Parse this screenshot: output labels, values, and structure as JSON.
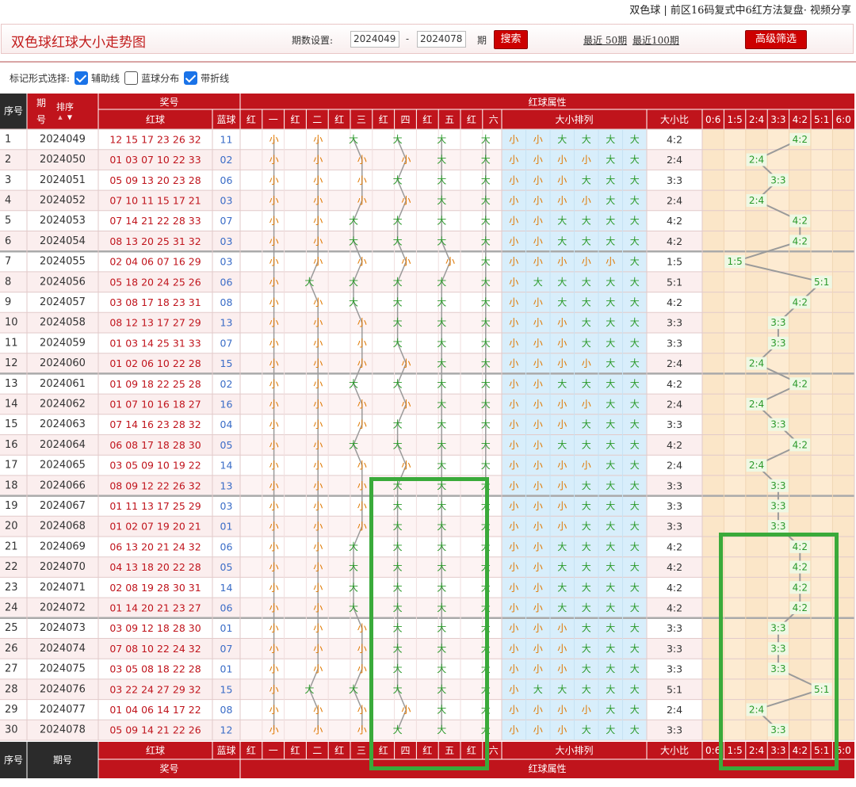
{
  "topbar": {
    "title": "双色球 | 前区16码复式中6红方法复盘· 视频分享"
  },
  "header": {
    "title": "双色球红球大小走势图",
    "period_label": "期数设置:",
    "period_from": "2024049",
    "period_sep": "-",
    "period_to": "2024078",
    "period_unit": "期",
    "search_label": "搜索",
    "recent50_label": "最近 50期",
    "recent100_label": "最近100期",
    "advanced_label": "高级筛选"
  },
  "options": {
    "label": "标记形式选择:",
    "items": [
      {
        "label": "辅助线",
        "checked": true
      },
      {
        "label": "蓝球分布",
        "checked": false
      },
      {
        "label": "带折线",
        "checked": true
      }
    ]
  },
  "table": {
    "head": {
      "seq": "序号",
      "issue": "期号",
      "issue_top": "期",
      "issue_bottom": "号",
      "sort": "排序",
      "prize": "奖号",
      "red_ball": "红球",
      "blue_ball": "蓝球",
      "attr": "红球属性",
      "positions": [
        "红",
        "一",
        "红",
        "二",
        "红",
        "三",
        "红",
        "四",
        "红",
        "五",
        "红",
        "六"
      ],
      "size_arrange": "大小排列",
      "ratio": "大小比",
      "ratio_cols": [
        "0:6",
        "1:5",
        "2:4",
        "3:3",
        "4:2",
        "5:1",
        "6:0"
      ]
    },
    "rows": [
      {
        "seq": "1",
        "issue": "2024049",
        "red": "12 15 17 23 26 32",
        "blue": "11",
        "sizes": [
          "小",
          "小",
          "大",
          "大",
          "大",
          "大"
        ],
        "ratio": "4:2"
      },
      {
        "seq": "2",
        "issue": "2024050",
        "red": "01 03 07 10 22 33",
        "blue": "02",
        "sizes": [
          "小",
          "小",
          "小",
          "小",
          "大",
          "大"
        ],
        "ratio": "2:4"
      },
      {
        "seq": "3",
        "issue": "2024051",
        "red": "05 09 13 20 23 28",
        "blue": "06",
        "sizes": [
          "小",
          "小",
          "小",
          "大",
          "大",
          "大"
        ],
        "ratio": "3:3"
      },
      {
        "seq": "4",
        "issue": "2024052",
        "red": "07 10 11 15 17 21",
        "blue": "03",
        "sizes": [
          "小",
          "小",
          "小",
          "小",
          "大",
          "大"
        ],
        "ratio": "2:4"
      },
      {
        "seq": "5",
        "issue": "2024053",
        "red": "07 14 21 22 28 33",
        "blue": "07",
        "sizes": [
          "小",
          "小",
          "大",
          "大",
          "大",
          "大"
        ],
        "ratio": "4:2"
      },
      {
        "seq": "6",
        "issue": "2024054",
        "red": "08 13 20 25 31 32",
        "blue": "03",
        "sizes": [
          "小",
          "小",
          "大",
          "大",
          "大",
          "大"
        ],
        "ratio": "4:2"
      },
      {
        "seq": "7",
        "issue": "2024055",
        "red": "02 04 06 07 16 29",
        "blue": "03",
        "sizes": [
          "小",
          "小",
          "小",
          "小",
          "小",
          "大"
        ],
        "ratio": "1:5"
      },
      {
        "seq": "8",
        "issue": "2024056",
        "red": "05 18 20 24 25 26",
        "blue": "06",
        "sizes": [
          "小",
          "大",
          "大",
          "大",
          "大",
          "大"
        ],
        "ratio": "5:1"
      },
      {
        "seq": "9",
        "issue": "2024057",
        "red": "03 08 17 18 23 31",
        "blue": "08",
        "sizes": [
          "小",
          "小",
          "大",
          "大",
          "大",
          "大"
        ],
        "ratio": "4:2"
      },
      {
        "seq": "10",
        "issue": "2024058",
        "red": "08 12 13 17 27 29",
        "blue": "13",
        "sizes": [
          "小",
          "小",
          "小",
          "大",
          "大",
          "大"
        ],
        "ratio": "3:3"
      },
      {
        "seq": "11",
        "issue": "2024059",
        "red": "01 03 14 25 31 33",
        "blue": "07",
        "sizes": [
          "小",
          "小",
          "小",
          "大",
          "大",
          "大"
        ],
        "ratio": "3:3"
      },
      {
        "seq": "12",
        "issue": "2024060",
        "red": "01 02 06 10 22 28",
        "blue": "15",
        "sizes": [
          "小",
          "小",
          "小",
          "小",
          "大",
          "大"
        ],
        "ratio": "2:4"
      },
      {
        "seq": "13",
        "issue": "2024061",
        "red": "01 09 18 22 25 28",
        "blue": "02",
        "sizes": [
          "小",
          "小",
          "大",
          "大",
          "大",
          "大"
        ],
        "ratio": "4:2"
      },
      {
        "seq": "14",
        "issue": "2024062",
        "red": "01 07 10 16 18 27",
        "blue": "16",
        "sizes": [
          "小",
          "小",
          "小",
          "小",
          "大",
          "大"
        ],
        "ratio": "2:4"
      },
      {
        "seq": "15",
        "issue": "2024063",
        "red": "07 14 16 23 28 32",
        "blue": "04",
        "sizes": [
          "小",
          "小",
          "小",
          "大",
          "大",
          "大"
        ],
        "ratio": "3:3"
      },
      {
        "seq": "16",
        "issue": "2024064",
        "red": "06 08 17 18 28 30",
        "blue": "05",
        "sizes": [
          "小",
          "小",
          "大",
          "大",
          "大",
          "大"
        ],
        "ratio": "4:2"
      },
      {
        "seq": "17",
        "issue": "2024065",
        "red": "03 05 09 10 19 22",
        "blue": "14",
        "sizes": [
          "小",
          "小",
          "小",
          "小",
          "大",
          "大"
        ],
        "ratio": "2:4"
      },
      {
        "seq": "18",
        "issue": "2024066",
        "red": "08 09 12 22 26 32",
        "blue": "13",
        "sizes": [
          "小",
          "小",
          "小",
          "大",
          "大",
          "大"
        ],
        "ratio": "3:3"
      },
      {
        "seq": "19",
        "issue": "2024067",
        "red": "01 11 13 17 25 29",
        "blue": "03",
        "sizes": [
          "小",
          "小",
          "小",
          "大",
          "大",
          "大"
        ],
        "ratio": "3:3"
      },
      {
        "seq": "20",
        "issue": "2024068",
        "red": "01 02 07 19 20 21",
        "blue": "01",
        "sizes": [
          "小",
          "小",
          "小",
          "大",
          "大",
          "大"
        ],
        "ratio": "3:3"
      },
      {
        "seq": "21",
        "issue": "2024069",
        "red": "06 13 20 21 24 32",
        "blue": "06",
        "sizes": [
          "小",
          "小",
          "大",
          "大",
          "大",
          "大"
        ],
        "ratio": "4:2"
      },
      {
        "seq": "22",
        "issue": "2024070",
        "red": "04 13 18 20 22 28",
        "blue": "05",
        "sizes": [
          "小",
          "小",
          "大",
          "大",
          "大",
          "大"
        ],
        "ratio": "4:2"
      },
      {
        "seq": "23",
        "issue": "2024071",
        "red": "02 08 19 28 30 31",
        "blue": "14",
        "sizes": [
          "小",
          "小",
          "大",
          "大",
          "大",
          "大"
        ],
        "ratio": "4:2"
      },
      {
        "seq": "24",
        "issue": "2024072",
        "red": "01 14 20 21 23 27",
        "blue": "06",
        "sizes": [
          "小",
          "小",
          "大",
          "大",
          "大",
          "大"
        ],
        "ratio": "4:2"
      },
      {
        "seq": "25",
        "issue": "2024073",
        "red": "03 09 12 18 28 30",
        "blue": "01",
        "sizes": [
          "小",
          "小",
          "小",
          "大",
          "大",
          "大"
        ],
        "ratio": "3:3"
      },
      {
        "seq": "26",
        "issue": "2024074",
        "red": "07 08 10 22 24 32",
        "blue": "07",
        "sizes": [
          "小",
          "小",
          "小",
          "大",
          "大",
          "大"
        ],
        "ratio": "3:3"
      },
      {
        "seq": "27",
        "issue": "2024075",
        "red": "03 05 08 18 22 28",
        "blue": "01",
        "sizes": [
          "小",
          "小",
          "小",
          "大",
          "大",
          "大"
        ],
        "ratio": "3:3"
      },
      {
        "seq": "28",
        "issue": "2024076",
        "red": "03 22 24 27 29 32",
        "blue": "15",
        "sizes": [
          "小",
          "大",
          "大",
          "大",
          "大",
          "大"
        ],
        "ratio": "5:1"
      },
      {
        "seq": "29",
        "issue": "2024077",
        "red": "01 04 06 14 17 22",
        "blue": "08",
        "sizes": [
          "小",
          "小",
          "小",
          "小",
          "大",
          "大"
        ],
        "ratio": "2:4"
      },
      {
        "seq": "30",
        "issue": "2024078",
        "red": "05 09 14 21 22 26",
        "blue": "12",
        "sizes": [
          "小",
          "小",
          "小",
          "大",
          "大",
          "大"
        ],
        "ratio": "3:3"
      }
    ],
    "foot": {
      "seq": "序号",
      "issue": "期号",
      "red_ball": "红球",
      "blue_ball": "蓝球",
      "prize": "奖号",
      "attr": "红球属性",
      "size_arrange": "大小排列",
      "ratio": "大小比"
    }
  },
  "colors": {
    "header_red": "#c0141c",
    "red_text": "#c0141c",
    "blue_text": "#3a6cc7",
    "green_big": "#2b9a2b",
    "orange_small": "#e07800",
    "highlight": "#3aaa3a"
  }
}
